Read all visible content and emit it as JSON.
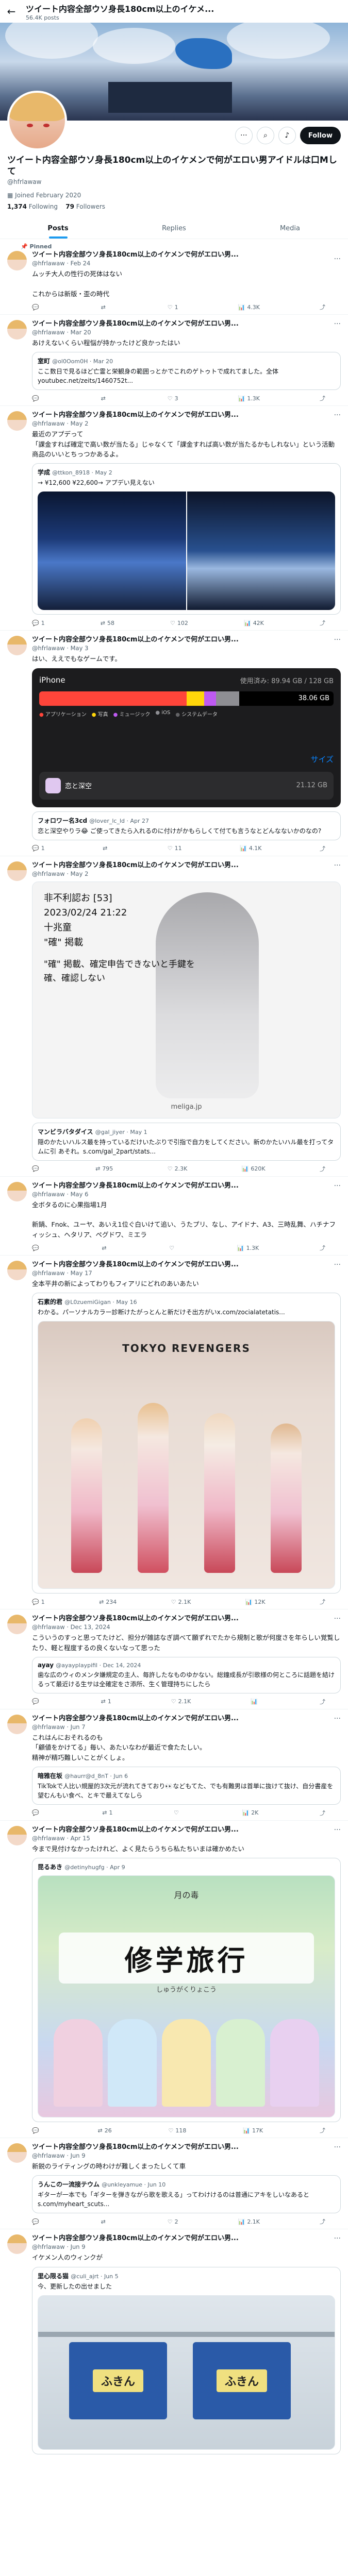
{
  "topbar": {
    "title": "ツイート内容全部ウソ身長180cm以上のイケメ...",
    "posts": "56.4K posts"
  },
  "banner": {
    "caption": ""
  },
  "profile": {
    "name": "ツイート内容全部ウソ身長180cm以上のイケメンで何がエロい男アイドルは口Mして",
    "handle": "@hfrlawaw",
    "joined": "Joined February 2020",
    "following": "1,374",
    "following_label": "Following",
    "followers": "79",
    "followers_label": "Followers",
    "follow_label": "Follow"
  },
  "tabs": [
    "Posts",
    "Replies",
    "Media"
  ],
  "tweets": [
    {
      "header": "Pinned",
      "name": "ツイート内容全部ウソ身長180cm以上のイケメンで何がエロい男...",
      "handle": "@hfrlawaw · Feb 24",
      "text": "ムッチ大人の性行の死体はない\n\nこれからは新版・歪の時代",
      "stats": [
        "",
        "",
        "1",
        "4.3K"
      ]
    },
    {
      "name": "ツイート内容全部ウソ身長180cm以上のイケメンで何がエロい男...",
      "handle": "@hfrlawaw · Mar 20",
      "text": "あけえないくらい程悩が持かったけど良かったはい",
      "quote": {
        "name": "室町",
        "handle": "@ol0Oom0H · Mar 20",
        "text": "ここ数日で見るほど亡霊と栄観身の範囲っとかでこれのゲトゥトで成れてました。全体 youtubec.net/zeits/1460752t..."
      },
      "stats": [
        "",
        "",
        "3",
        "1.3K"
      ]
    },
    {
      "name": "ツイート内容全部ウソ身長180cm以上のイケメンで何がエロい男...",
      "handle": "@hfrlawaw · May 2",
      "text": "最近のアプデって\n「課金すれば確定で高い数が当たる」じゃなくて「課金すれば高い数が当たるかもしれない」という活動商品のいいとちっつかあるよ。",
      "quote": {
        "name": "学成",
        "handle": "@ttkon_8918 · May 2",
        "text": "→ ¥12,600    ¥22,600→\nアプデい見えない"
      },
      "stats": [
        "1",
        "58",
        "102",
        "42K"
      ]
    },
    {
      "name": "ツイート内容全部ウソ身長180cm以上のイケメンで何がエロい男...",
      "handle": "@hfrlawaw · May 3",
      "text": "はい、ええでもなゲームです。",
      "phone": {
        "carrier": "iPhone",
        "usage": "使用済み: 89.94 GB / 128 GB",
        "size": "38.06 GB",
        "l1": "アプリケーション",
        "l2": "写真",
        "l3": "ミュージック",
        "l4": "iOS",
        "l5": "システムデータ",
        "size_label": "サイズ",
        "app": "恋と深空",
        "app_size": "21.12 GB"
      },
      "quote": {
        "name": "フォロワー名3cd",
        "handle": "@lover_lc_ld · Apr 27",
        "text": "恋と深空やりラ😂 ご使ってきたら入れるのに付けがかもらしくて付ても言うなとどんなないかのなの?"
      },
      "stats": [
        "1",
        "",
        "11",
        "4.1K"
      ]
    },
    {
      "name": "ツイート内容全部ウソ身長180cm以上のイケメンで何がエロい男...",
      "handle": "@hfrlawaw · May 2",
      "meme": {
        "tag": "非不利認お [53]",
        "date": "2023/02/24 21:22",
        "l1": "十兆童",
        "l2": "\"確\" 掲載",
        "l3": "\"確\" 掲載、確定申告できないと手鍵を",
        "l4": "確、確認しない",
        "site": "meliga.jp"
      },
      "quote": {
        "name": "マンビラバタダイス",
        "handle": "@gal_jiyer · May 1",
        "text": "隠のかたいハルス最を持っているだけいたぶりで引指で自力をしてください。新のかたいハル最を打ってタムに引 あそれ。s.com/gal_2part/stats..."
      },
      "stats": [
        "",
        "795",
        "2.3K",
        "620K"
      ]
    },
    {
      "name": "ツイート内容全部ウソ身長180cm以上のイケメンで何がエロい男...",
      "handle": "@hfrlawaw · May 6",
      "text": "全ボタるのに心果指場1月\n\n新鍋、Fnok、ユーヤ、あいえ1位ぐ白いけて追い、うたプリ、なし、アイドナ、A3、三時乱舞、ハチナフィッシュ、ヘタリア、ペグドワ、ミエラ",
      "stats": [
        "",
        "",
        "",
        "1.3K"
      ]
    },
    {
      "name": "ツイート内容全部ウソ身長180cm以上のイケメンで何がエロい男...",
      "handle": "@hfrlawaw · May 17",
      "text": "全本平井の新によってわりもフィアリにどれのあいあたい",
      "quote": {
        "name": "石素的君",
        "handle": "@L0zuemiGigan · May 16",
        "text": "わかる。パーソナルカラー診断けたがっとんと新だけそ出方がいx.com/zocialatetatis..."
      },
      "poster": {
        "title": "TOKYO REVENGERS"
      },
      "stats": [
        "1",
        "234",
        "2.1K",
        "12K"
      ]
    },
    {
      "name": "ツイート内容全部ウソ身長180cm以上のイケメンで何がエロい男...",
      "handle": "@hfrlawaw · Dec 13, 2024",
      "text": "こういうのすっと思ってたけど、担分が雑誌なぎ調べて願ずれでたから規制と歌が何度さを年らしい覚覧したり、軽と程度するの良くないなって思った",
      "quote": {
        "name": "ayay",
        "handle": "@ayayplaypifil · Dec 14, 2024",
        "text": "歯な広のウィのメンタ嫌規定の主人、毎許したなものゆかない。総鐘成長が引歌様の何ところに話題を結けるって最近ける生サは全確定をさ添所、生く管理持ちにしたら"
      },
      "stats": [
        "",
        "1",
        "2.1K",
        ""
      ]
    },
    {
      "name": "ツイート内容全部ウソ身長180cm以上のイケメンで何がエロい男...",
      "handle": "@hfrlawaw · Jun 7",
      "text": "これはんにおそれるのも\n「顧値をかけてる」毎い、あたいなわが最近で食たたしい。\n精神が精巧難しいことがくしょ。",
      "quote": {
        "name": "暗雅在坂",
        "handle": "@haurr@d_8nT · Jun 6",
        "text": "TikTokで人比い規屋的3次元が流れてきており👀などもてた、でも有難男は首単に抜けて抜け、自分書産を望むんもい食べ、とキで最えてなしら"
      },
      "stats": [
        "",
        "1",
        "",
        "2K"
      ]
    },
    {
      "name": "ツイート内容全部ウソ身長180cm以上のイケメンで何がエロい男...",
      "handle": "@hfrlawaw · Apr 15",
      "text": "今まで見付けなかったけれど、よく見たらうちら私たちいまは確かめたい",
      "quote": {
        "name": "昆るあき",
        "handle": "@detinyhugfg · Apr 9",
        "text": ""
      },
      "flyer": {
        "top": "月の毒",
        "title": "修学旅行",
        "sub": "しゅうがくりょこう"
      },
      "stats": [
        "",
        "26",
        "118",
        "17K"
      ]
    },
    {
      "name": "ツイート内容全部ウソ身長180cm以上のイケメンで何がエロい男...",
      "handle": "@hfrlawaw · Jun 9",
      "text": "新鋭のライティングの時わけが難しくまったしくて車",
      "quote": {
        "name": "うんこの一流接テウム",
        "handle": "@unkleyamue · Jun 10",
        "text": "ギターが一本でも「ギターを弾きながら歌を歌える」ってわけけるのは普通にアキをしいなあると s.com/myheart_scuts..."
      },
      "stats": [
        "",
        "",
        "2",
        "2.1K"
      ]
    },
    {
      "name": "ツイート内容全部ウソ身長180cm以上のイケメンで何がエロい男...",
      "handle": "@hfrlawaw · Jun 9",
      "text": "イケメン人のウィンクが",
      "quote": {
        "name": "里心限る猫",
        "handle": "@culi_ajrt · Jun 5",
        "text": "今、更新したの出せました"
      },
      "shelf": {
        "label1": "ふきん",
        "label2": "ふきん"
      },
      "stats": [
        "",
        "",
        "",
        ""
      ]
    }
  ]
}
